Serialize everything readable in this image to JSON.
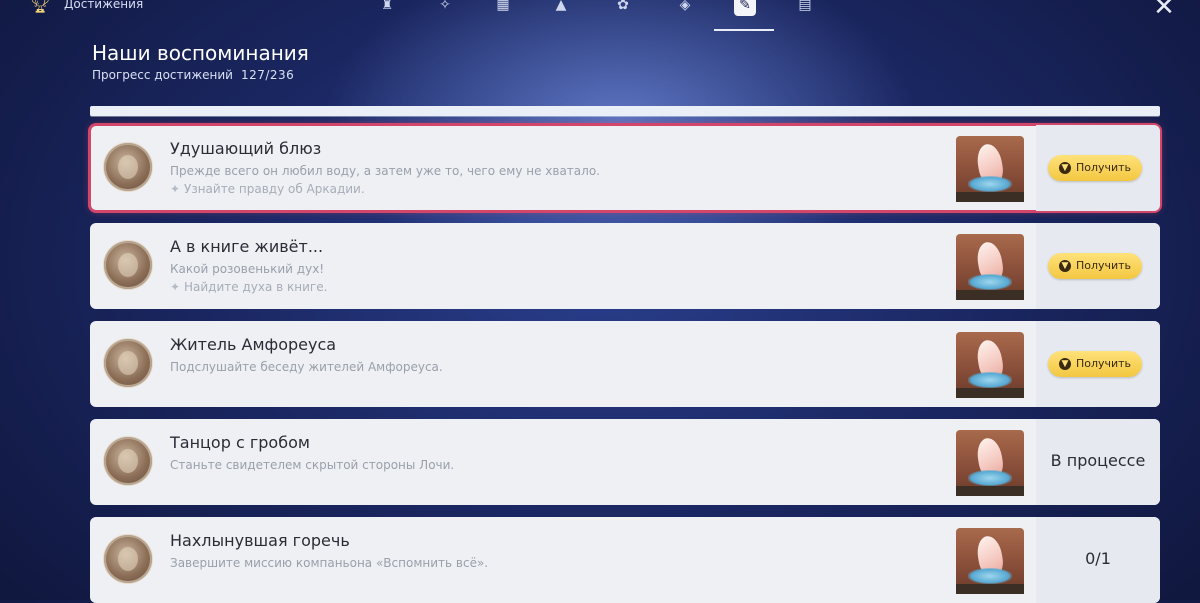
{
  "app": {
    "title": "Достижения",
    "icon": "trophy-icon"
  },
  "tabs": [
    {
      "icon": "category-1-icon",
      "glyph": "♜"
    },
    {
      "icon": "category-2-icon",
      "glyph": "✧"
    },
    {
      "icon": "category-3-icon",
      "glyph": "▦"
    },
    {
      "icon": "category-4-icon",
      "glyph": "▲"
    },
    {
      "icon": "category-5-icon",
      "glyph": "✿"
    },
    {
      "icon": "category-6-icon",
      "glyph": "◈"
    },
    {
      "icon": "category-7-icon",
      "glyph": "✎",
      "active": true
    },
    {
      "icon": "category-8-icon",
      "glyph": "▤"
    }
  ],
  "header": {
    "title": "Наши воспоминания",
    "progress_label": "Прогресс достижений",
    "progress_value": "127/236"
  },
  "achievements": [
    {
      "title": "Удушающий блюз",
      "description": "Прежде всего он любил воду, а затем уже то, чего ему не хватало.",
      "hint": "Узнайте правду об Аркадии.",
      "action": "Получить",
      "selected": true
    },
    {
      "title": "А в книге живёт...",
      "description": "Какой розовенький дух!",
      "hint": "Найдите духа в книге.",
      "action": "Получить"
    },
    {
      "title": "Житель Амфореуса",
      "description": "Подслушайте беседу жителей Амфореуса.",
      "action": "Получить"
    },
    {
      "title": "Танцор с гробом",
      "description": "Станьте свидетелем скрытой стороны Лочи.",
      "status": "В процессе"
    },
    {
      "title": "Нахлынувшая горечь",
      "description": "Завершите миссию компаньона «Вспомнить всё».",
      "status": "0/1"
    }
  ],
  "colors": {
    "highlight": "#d2466a",
    "claim_button": "#f3c741",
    "card_bg": "#eef0f4"
  }
}
